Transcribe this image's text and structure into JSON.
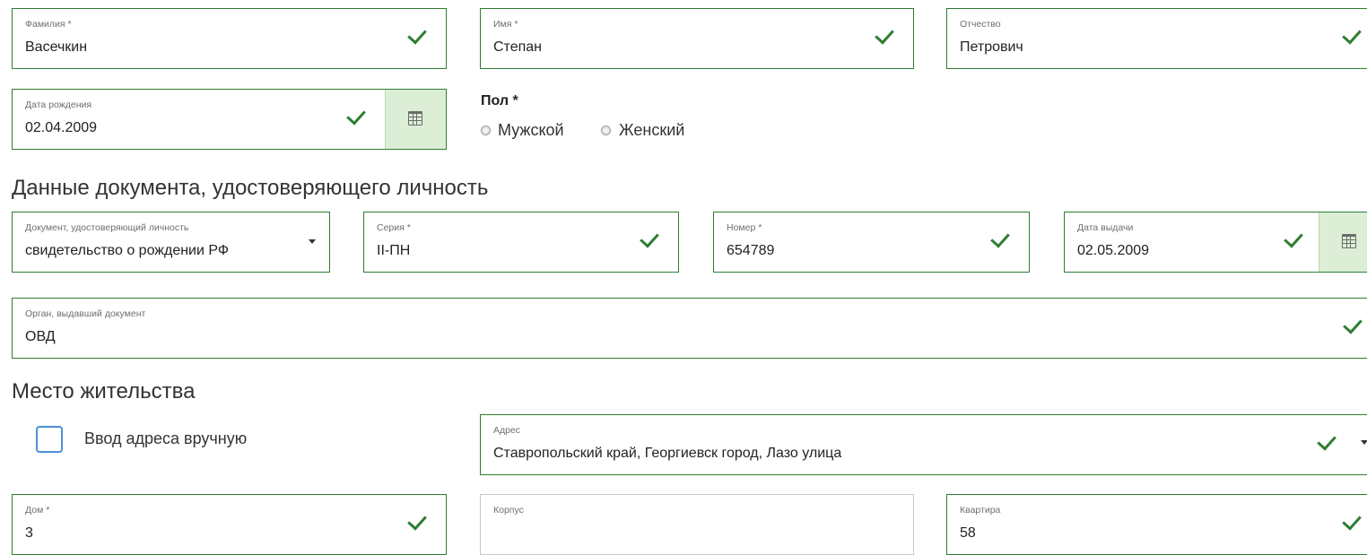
{
  "personal": {
    "last_name": {
      "label": "Фамилия *",
      "value": "Васечкин"
    },
    "first_name": {
      "label": "Имя *",
      "value": "Степан"
    },
    "patronymic": {
      "label": "Отчество",
      "value": "Петрович"
    },
    "birth_date": {
      "label": "Дата рождения",
      "value": "02.04.2009"
    },
    "gender": {
      "title": "Пол *",
      "options": [
        "Мужской",
        "Женский"
      ]
    }
  },
  "document": {
    "section_title": "Данные документа, удостоверяющего личность",
    "doc_type": {
      "label": "Документ, удостоверяющий личность",
      "value": "свидетельство о рождении РФ"
    },
    "series": {
      "label": "Серия *",
      "value": "II-ПН"
    },
    "number": {
      "label": "Номер *",
      "value": "654789"
    },
    "issue_date": {
      "label": "Дата выдачи",
      "value": "02.05.2009"
    },
    "issuer": {
      "label": "Орган, выдавший документ",
      "value": "ОВД"
    }
  },
  "residence": {
    "section_title": "Место жительства",
    "manual_address_label": "Ввод адреса вручную",
    "address": {
      "label": "Адрес",
      "value": "Ставропольский край, Георгиевск город, Лазо улица"
    },
    "house": {
      "label": "Дом *",
      "value": "3"
    },
    "building": {
      "label": "Корпус",
      "value": ""
    },
    "apartment": {
      "label": "Квартира",
      "value": "58"
    }
  },
  "colors": {
    "valid_border": "#2e7d32",
    "check": "#2e7d32",
    "calendar_bg": "#dcefd6",
    "checkbox_border": "#4a90d9",
    "empty_border": "#c8c8c8"
  },
  "icons": [
    "check-icon",
    "calendar-icon",
    "dropdown-caret-icon",
    "radio-icon",
    "checkbox-icon"
  ]
}
